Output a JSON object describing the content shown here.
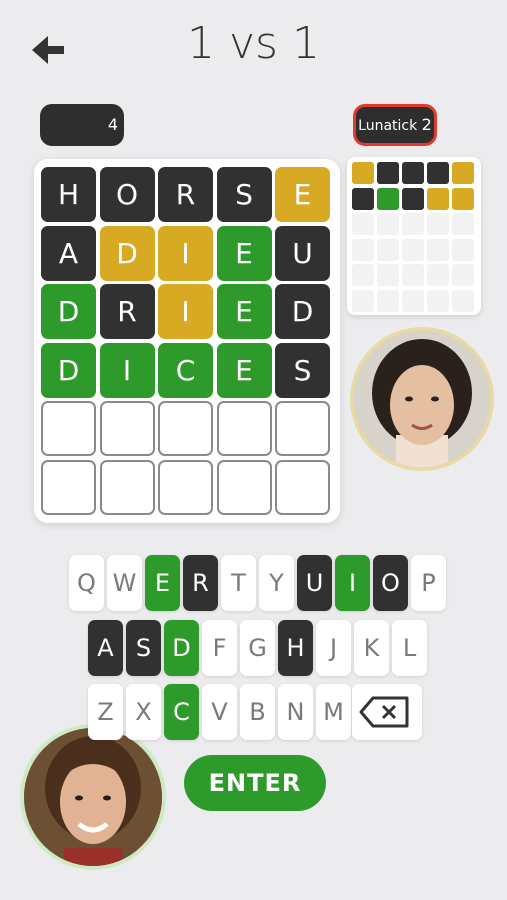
{
  "header": {
    "title": "1 vs 1",
    "back_icon": "back-arrow-icon"
  },
  "players": {
    "me": {
      "score": "4",
      "avatar_icon": "player-avatar-icon"
    },
    "opponent": {
      "name": "Lunatick",
      "score": "2",
      "avatar_icon": "opponent-avatar-icon"
    }
  },
  "colors": {
    "green": "#2f9a2c",
    "yellow": "#d8aa23",
    "dark": "#313131",
    "opponent_border": "#e23b2e"
  },
  "board": {
    "rows": [
      [
        {
          "l": "H",
          "s": "d"
        },
        {
          "l": "O",
          "s": "d"
        },
        {
          "l": "R",
          "s": "d"
        },
        {
          "l": "S",
          "s": "d"
        },
        {
          "l": "E",
          "s": "y"
        }
      ],
      [
        {
          "l": "A",
          "s": "d"
        },
        {
          "l": "D",
          "s": "y"
        },
        {
          "l": "I",
          "s": "y"
        },
        {
          "l": "E",
          "s": "g"
        },
        {
          "l": "U",
          "s": "d"
        }
      ],
      [
        {
          "l": "D",
          "s": "g"
        },
        {
          "l": "R",
          "s": "d"
        },
        {
          "l": "I",
          "s": "y"
        },
        {
          "l": "E",
          "s": "g"
        },
        {
          "l": "D",
          "s": "d"
        }
      ],
      [
        {
          "l": "D",
          "s": "g"
        },
        {
          "l": "I",
          "s": "g"
        },
        {
          "l": "C",
          "s": "g"
        },
        {
          "l": "E",
          "s": "g"
        },
        {
          "l": "S",
          "s": "d"
        }
      ],
      [
        {
          "l": "",
          "s": "e"
        },
        {
          "l": "",
          "s": "e"
        },
        {
          "l": "",
          "s": "e"
        },
        {
          "l": "",
          "s": "e"
        },
        {
          "l": "",
          "s": "e"
        }
      ],
      [
        {
          "l": "",
          "s": "e"
        },
        {
          "l": "",
          "s": "e"
        },
        {
          "l": "",
          "s": "e"
        },
        {
          "l": "",
          "s": "e"
        },
        {
          "l": "",
          "s": "e"
        }
      ]
    ]
  },
  "opponent_board": {
    "rows": [
      [
        "y",
        "d",
        "d",
        "d",
        "y"
      ],
      [
        "d",
        "g",
        "d",
        "y",
        "y"
      ],
      [
        "e",
        "e",
        "e",
        "e",
        "e"
      ],
      [
        "e",
        "e",
        "e",
        "e",
        "e"
      ],
      [
        "e",
        "e",
        "e",
        "e",
        "e"
      ],
      [
        "e",
        "e",
        "e",
        "e",
        "e"
      ]
    ]
  },
  "keyboard": {
    "rows": [
      [
        {
          "k": "Q",
          "s": ""
        },
        {
          "k": "W",
          "s": ""
        },
        {
          "k": "E",
          "s": "g"
        },
        {
          "k": "R",
          "s": "d"
        },
        {
          "k": "T",
          "s": ""
        },
        {
          "k": "Y",
          "s": ""
        },
        {
          "k": "U",
          "s": "d"
        },
        {
          "k": "I",
          "s": "g"
        },
        {
          "k": "O",
          "s": "d"
        },
        {
          "k": "P",
          "s": ""
        }
      ],
      [
        {
          "k": "A",
          "s": "d"
        },
        {
          "k": "S",
          "s": "d"
        },
        {
          "k": "D",
          "s": "g"
        },
        {
          "k": "F",
          "s": ""
        },
        {
          "k": "G",
          "s": ""
        },
        {
          "k": "H",
          "s": "d"
        },
        {
          "k": "J",
          "s": ""
        },
        {
          "k": "K",
          "s": ""
        },
        {
          "k": "L",
          "s": ""
        }
      ],
      [
        {
          "k": "Z",
          "s": ""
        },
        {
          "k": "X",
          "s": ""
        },
        {
          "k": "C",
          "s": "g"
        },
        {
          "k": "V",
          "s": ""
        },
        {
          "k": "B",
          "s": ""
        },
        {
          "k": "N",
          "s": ""
        },
        {
          "k": "M",
          "s": ""
        }
      ]
    ],
    "backspace_icon": "backspace-icon",
    "enter_label": "ENTER"
  }
}
